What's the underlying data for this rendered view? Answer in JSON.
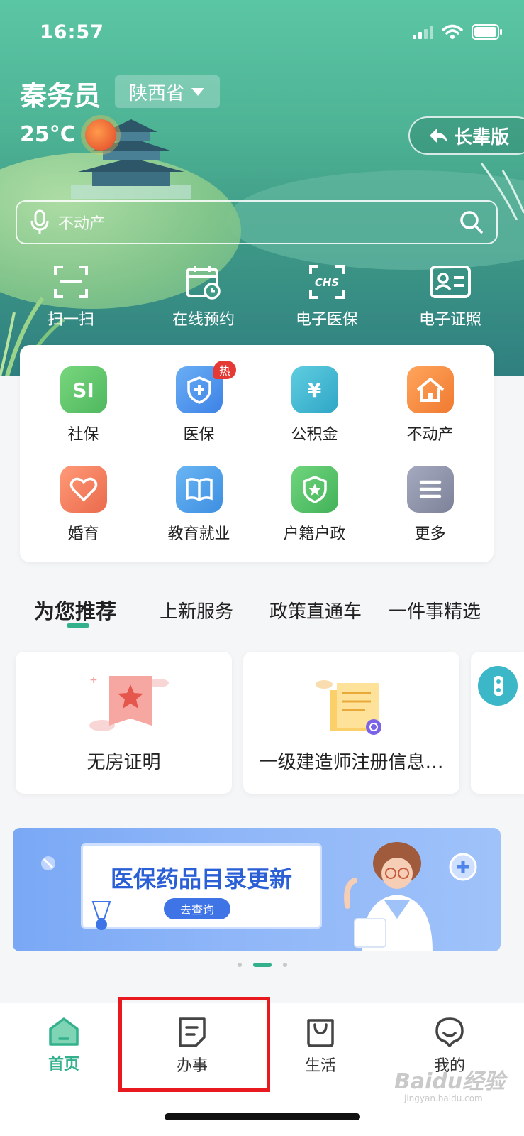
{
  "status_bar": {
    "time": "16:57"
  },
  "header": {
    "user_name": "秦务员",
    "province": "陕西省",
    "temperature": "25°C",
    "elder_mode_label": "长辈版"
  },
  "search": {
    "placeholder": "不动产"
  },
  "quick_actions": [
    {
      "label": "扫一扫",
      "icon": "scan-icon"
    },
    {
      "label": "在线预约",
      "icon": "calendar-clock-icon"
    },
    {
      "label": "电子医保",
      "icon": "chs-icon"
    },
    {
      "label": "电子证照",
      "icon": "id-card-icon"
    }
  ],
  "services": [
    {
      "label": "社保",
      "icon": "si-icon",
      "glyph": "SI",
      "color": "#5cc56a"
    },
    {
      "label": "医保",
      "icon": "shield-plus-icon",
      "color": "#4b92ef",
      "badge": "热"
    },
    {
      "label": "公积金",
      "icon": "yuan-icon",
      "glyph": "¥",
      "color": "#3bb5d0"
    },
    {
      "label": "不动产",
      "icon": "house-icon",
      "color": "#f58a3e"
    },
    {
      "label": "婚育",
      "icon": "heart-icon",
      "color": "#f27d5c"
    },
    {
      "label": "教育就业",
      "icon": "book-icon",
      "color": "#4fa0ea"
    },
    {
      "label": "户籍户政",
      "icon": "police-shield-icon",
      "color": "#52c06a"
    },
    {
      "label": "更多",
      "icon": "menu-icon",
      "color": "#8a8fa6"
    }
  ],
  "tabs": [
    {
      "label": "为您推荐",
      "active": true
    },
    {
      "label": "上新服务"
    },
    {
      "label": "政策直通车"
    },
    {
      "label": "一件事精选"
    }
  ],
  "recommend_cards": [
    {
      "title": "无房证明"
    },
    {
      "title": "一级建造师注册信息…"
    }
  ],
  "banner": {
    "title": "医保药品目录更新",
    "button": "去查询"
  },
  "bottom_nav": [
    {
      "label": "首页",
      "icon": "home-icon",
      "active": true
    },
    {
      "label": "办事",
      "icon": "document-icon"
    },
    {
      "label": "生活",
      "icon": "bag-icon"
    },
    {
      "label": "我的",
      "icon": "profile-icon"
    }
  ],
  "watermark": {
    "text": "Baidu经验",
    "sub": "jingyan.baidu.com"
  },
  "colors": {
    "accent": "#33b08c",
    "highlight_box": "#e8191f"
  }
}
